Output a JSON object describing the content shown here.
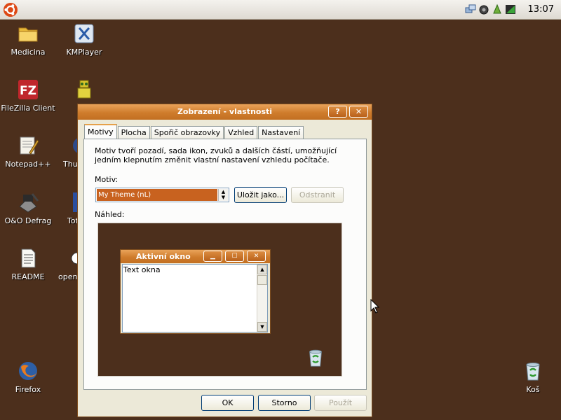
{
  "topbar": {
    "clock": "13:07",
    "logo_icon": "ubuntu-logo-icon",
    "tray_icons": [
      "network-icon",
      "volume-icon",
      "update-icon",
      "battery-icon"
    ]
  },
  "desktop": {
    "icons": [
      {
        "label": "Medicina",
        "icon": "folder-icon"
      },
      {
        "label": "KMPlayer",
        "icon": "kmplayer-icon"
      },
      {
        "label": "FileZilla Client",
        "icon": "filezilla-icon"
      },
      {
        "label": "",
        "icon": "robot-icon"
      },
      {
        "label": "Notepad++",
        "icon": "notepad-icon"
      },
      {
        "label": "Thun",
        "icon": "thunderbird-icon"
      },
      {
        "label": "O&O Defrag",
        "icon": "defrag-icon"
      },
      {
        "label": "Tot",
        "icon": "app-icon"
      },
      {
        "label": "README",
        "icon": "document-icon"
      },
      {
        "label": "openI",
        "icon": "openoffice-icon"
      },
      {
        "label": "Firefox",
        "icon": "firefox-icon"
      },
      {
        "label": "Koš",
        "icon": "recycle-bin-icon"
      }
    ]
  },
  "dialog": {
    "title": "Zobrazení - vlastnosti",
    "help_label": "?",
    "close_label": "✕",
    "tabs": [
      {
        "label": "Motivy",
        "active": true
      },
      {
        "label": "Plocha"
      },
      {
        "label": "Spořič obrazovky"
      },
      {
        "label": "Vzhled"
      },
      {
        "label": "Nastavení"
      }
    ],
    "description": "Motiv tvoří pozadí, sada ikon, zvuků a dalších částí, umožňující jedním klepnutím změnit vlastní nastavení vzhledu počítače.",
    "theme_label": "Motiv:",
    "theme_value": "My Theme (nL)",
    "save_as_label": "Uložit jako...",
    "remove_label": "Odstranit",
    "preview_label": "Náhled:",
    "preview": {
      "window_title": "Aktivní okno",
      "window_text": "Text okna",
      "background_color": "#4c2f1c"
    },
    "ok_label": "OK",
    "cancel_label": "Storno",
    "apply_label": "Použít"
  },
  "colors": {
    "desktop": "#4c2f1c",
    "titlebar": "#cf7c2c",
    "selection": "#c8621f",
    "dialog_face": "#ece9d8"
  }
}
